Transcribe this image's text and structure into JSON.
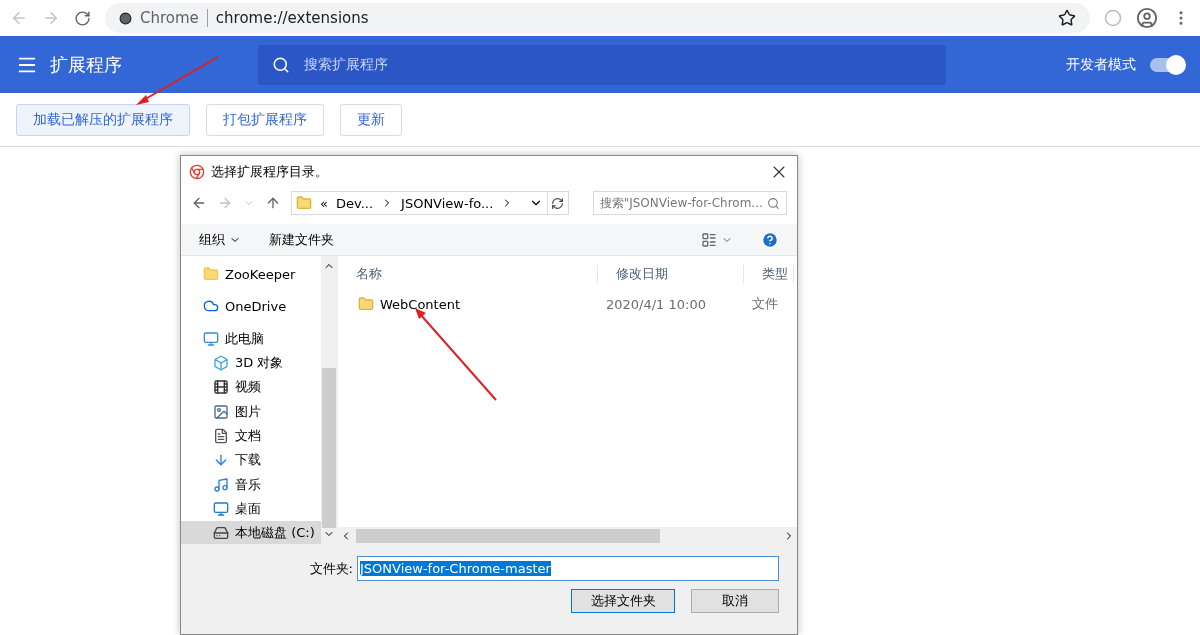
{
  "browser": {
    "site_label": "Chrome",
    "url": "chrome://extensions"
  },
  "header": {
    "title": "扩展程序",
    "search_placeholder": "搜索扩展程序",
    "dev_mode": {
      "label": "开发者模式",
      "on": true
    }
  },
  "actions": [
    {
      "label": "加载已解压的扩展程序",
      "focused": true
    },
    {
      "label": "打包扩展程序",
      "focused": false
    },
    {
      "label": "更新",
      "focused": false
    }
  ],
  "dialog": {
    "title": "选择扩展程序目录。",
    "breadcrumb_prefix": "«",
    "breadcrumb": [
      "Dev...",
      "JSONView-fo..."
    ],
    "search_placeholder": "搜索\"JSONView-for-Chrom...",
    "commands": {
      "organize": "组织",
      "new_folder": "新建文件夹"
    },
    "nav": [
      {
        "label": "ZooKeeper",
        "kind": "folder",
        "selected": false
      },
      {
        "label": "OneDrive",
        "kind": "cloud",
        "selected": false
      },
      {
        "label": "此电脑",
        "kind": "pc",
        "selected": false,
        "children": [
          {
            "label": "3D 对象",
            "kind": "cube",
            "selected": false
          },
          {
            "label": "视频",
            "kind": "video",
            "selected": false
          },
          {
            "label": "图片",
            "kind": "picture",
            "selected": false
          },
          {
            "label": "文档",
            "kind": "document",
            "selected": false
          },
          {
            "label": "下载",
            "kind": "download",
            "selected": false
          },
          {
            "label": "音乐",
            "kind": "music",
            "selected": false
          },
          {
            "label": "桌面",
            "kind": "desktop",
            "selected": false
          },
          {
            "label": "本地磁盘 (C:)",
            "kind": "drive",
            "selected": true
          }
        ]
      }
    ],
    "columns": [
      "名称",
      "修改日期",
      "类型"
    ],
    "rows": [
      {
        "name": "WebContent",
        "modified": "2020/4/1 10:00",
        "type": "文件"
      }
    ],
    "folder_label": "文件夹:",
    "folder_value": "JSONView-for-Chrome-master",
    "buttons": [
      {
        "label": "选择文件夹",
        "kind": "primary"
      },
      {
        "label": "取消",
        "kind": "secondary"
      }
    ]
  }
}
